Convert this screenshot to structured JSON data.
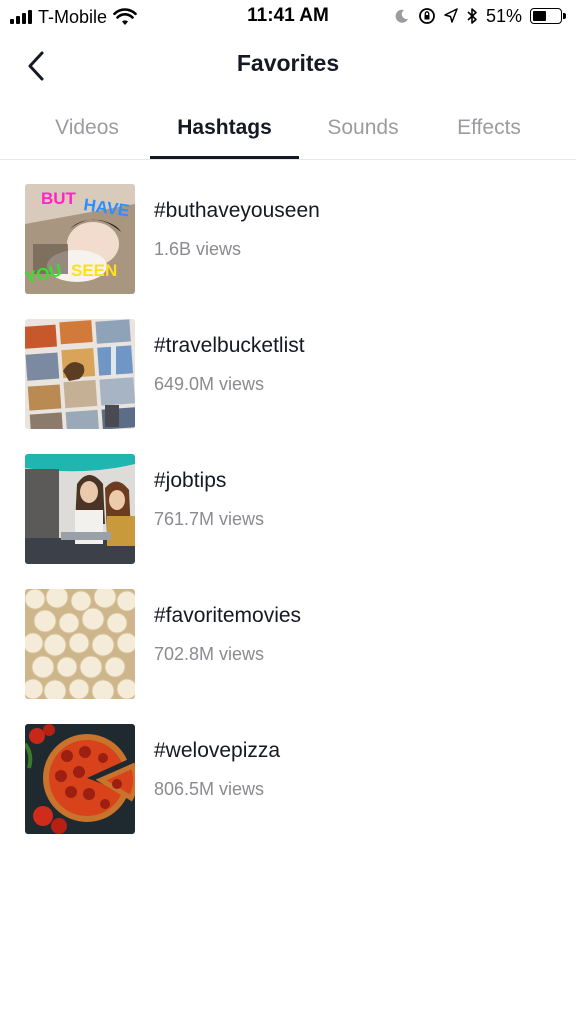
{
  "status_bar": {
    "carrier": "T-Mobile",
    "time": "11:41 AM",
    "battery_percent": "51%",
    "battery_level": 0.51
  },
  "header": {
    "title": "Favorites"
  },
  "tabs": [
    {
      "label": "Videos",
      "active": false
    },
    {
      "label": "Hashtags",
      "active": true
    },
    {
      "label": "Sounds",
      "active": false
    },
    {
      "label": "Effects",
      "active": false
    }
  ],
  "hashtags": [
    {
      "name": "#buthaveyouseen",
      "views": "1.6B views",
      "thumb_text_top": "BUT HAVE",
      "thumb_text_bottom": "YOU SEEN"
    },
    {
      "name": "#travelbucketlist",
      "views": "649.0M views"
    },
    {
      "name": "#jobtips",
      "views": "761.7M views"
    },
    {
      "name": "#favoritemovies",
      "views": "702.8M views"
    },
    {
      "name": "#welovepizza",
      "views": "806.5M views"
    }
  ]
}
